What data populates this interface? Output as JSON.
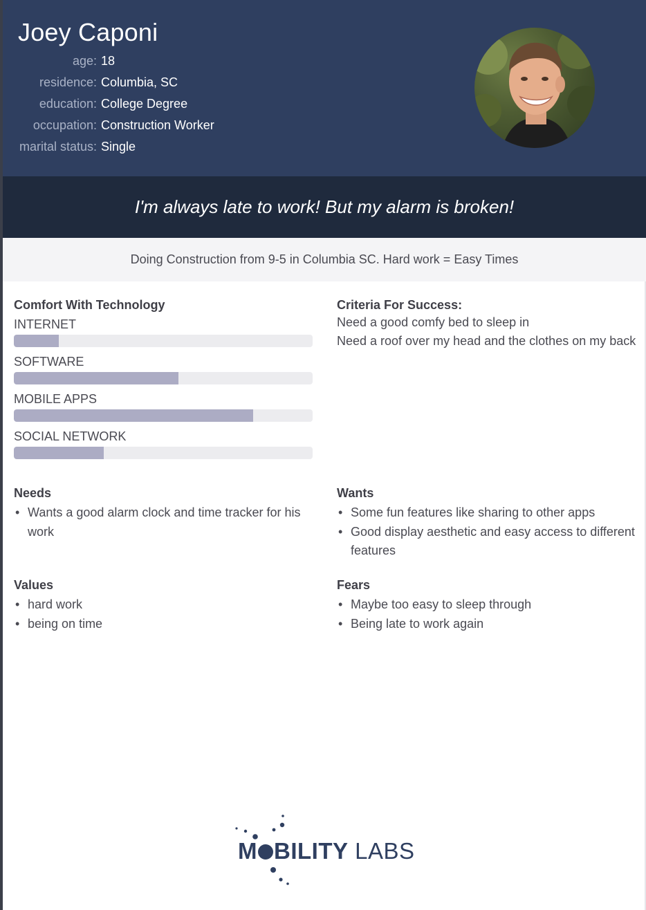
{
  "persona": {
    "name": "Joey Caponi",
    "details": [
      {
        "label": "age",
        "value": "18"
      },
      {
        "label": "residence",
        "value": "Columbia, SC"
      },
      {
        "label": "education",
        "value": "College Degree"
      },
      {
        "label": "occupation",
        "value": "Construction Worker"
      },
      {
        "label": "marital status",
        "value": "Single"
      }
    ],
    "quote": "I'm always late to work! But my alarm is broken!",
    "summary": "Doing Construction from 9-5 in Columbia SC. Hard work = Easy Times"
  },
  "technology": {
    "title": "Comfort With Technology",
    "skills": [
      {
        "label": "INTERNET",
        "level": 0.15
      },
      {
        "label": "SOFTWARE",
        "level": 0.55
      },
      {
        "label": "MOBILE APPS",
        "level": 0.8
      },
      {
        "label": "SOCIAL NETWORK",
        "level": 0.3
      }
    ]
  },
  "criteria": {
    "title": "Criteria For Success:",
    "lines": [
      "Need a good comfy bed to sleep in",
      "Need a roof over my head and the clothes on my back"
    ]
  },
  "needs": {
    "title": "Needs",
    "items": [
      "Wants a good alarm clock and time tracker for his work"
    ]
  },
  "wants": {
    "title": "Wants",
    "items": [
      "Some fun features like sharing to other apps",
      "Good display aesthetic and easy access to different features"
    ]
  },
  "values": {
    "title": "Values",
    "items": [
      "hard work",
      "being on time"
    ]
  },
  "fears": {
    "title": "Fears",
    "items": [
      "Maybe too easy to sleep through",
      "Being late to work again"
    ]
  },
  "logo": {
    "word_bold_prefix": "M",
    "word_bold_rest": "BILITY",
    "word_light": "LABS"
  },
  "colors": {
    "header_bg": "#2f3f60",
    "quote_bg": "#1f2a3d",
    "summary_bg": "#f4f4f6",
    "bar_fill": "#acacc4",
    "bar_track": "#ececef"
  }
}
